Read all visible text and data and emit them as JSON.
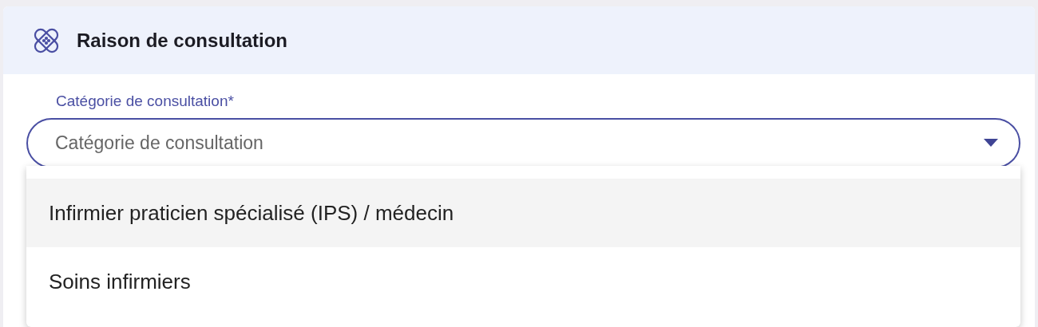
{
  "section": {
    "title": "Raison de consultation"
  },
  "field": {
    "label": "Catégorie de consultation*",
    "placeholder": "Catégorie de consultation",
    "expanded": true
  },
  "options": [
    {
      "label": "Infirmier praticien spécialisé (IPS) / médecin",
      "selected": true
    },
    {
      "label": "Soins infirmiers",
      "selected": false
    }
  ]
}
